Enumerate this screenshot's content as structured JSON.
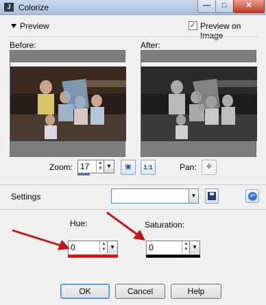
{
  "window": {
    "title": "Colorize",
    "app_icon": "J"
  },
  "controls": {
    "minimize": "minimize-icon",
    "maximize": "maximize-icon",
    "close": "close-icon"
  },
  "preview": {
    "toggle_label": "Preview",
    "show_preview_label": "Preview on Image",
    "show_preview_checked": true,
    "before_label": "Before:",
    "after_label": "After:"
  },
  "zoom": {
    "label": "Zoom:",
    "value": "17"
  },
  "pan": {
    "label": "Pan:"
  },
  "settings": {
    "label": "Settings",
    "preset_value": ""
  },
  "hue": {
    "label": "Hue:",
    "value": "0",
    "bar_color": "#e01010"
  },
  "saturation": {
    "label": "Saturation:",
    "value": "0",
    "bar_color": "#000000"
  },
  "annotations": {
    "arrow_color": "#c01818"
  },
  "buttons": {
    "ok": "OK",
    "cancel": "Cancel",
    "help": "Help"
  }
}
